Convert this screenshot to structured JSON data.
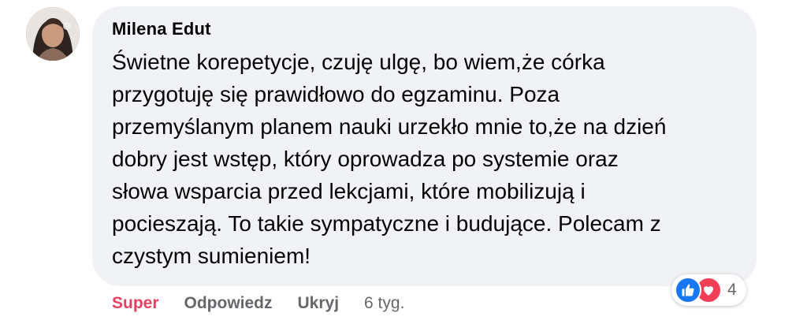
{
  "comment": {
    "author": "Milena Edut",
    "lines": [
      "Świetne korepetycje, czuję ulgę, bo wiem,że córka",
      "przygotuję się prawidłowo do egzaminu. Poza",
      "przemyślanym planem nauki urzekło mnie to,że na dzień",
      "dobry jest wstęp, który oprowadza po systemie oraz",
      "słowa wsparcia przed lekcjami, które mobilizują i",
      "pocieszają. To takie sympatyczne i budujące. Polecam z",
      "czystym sumieniem!"
    ]
  },
  "reactions": {
    "icons": [
      "like-icon",
      "love-icon"
    ],
    "count": "4",
    "colors": {
      "like": "#1877f2",
      "love": "#f33e58"
    }
  },
  "actions": {
    "reaction_label": "Super",
    "reply_label": "Odpowiedz",
    "hide_label": "Ukryj",
    "timestamp": "6 tyg."
  },
  "colors": {
    "bubble": "#f0f2f5",
    "super": "#e4405f",
    "secondary_text": "#65676b"
  }
}
